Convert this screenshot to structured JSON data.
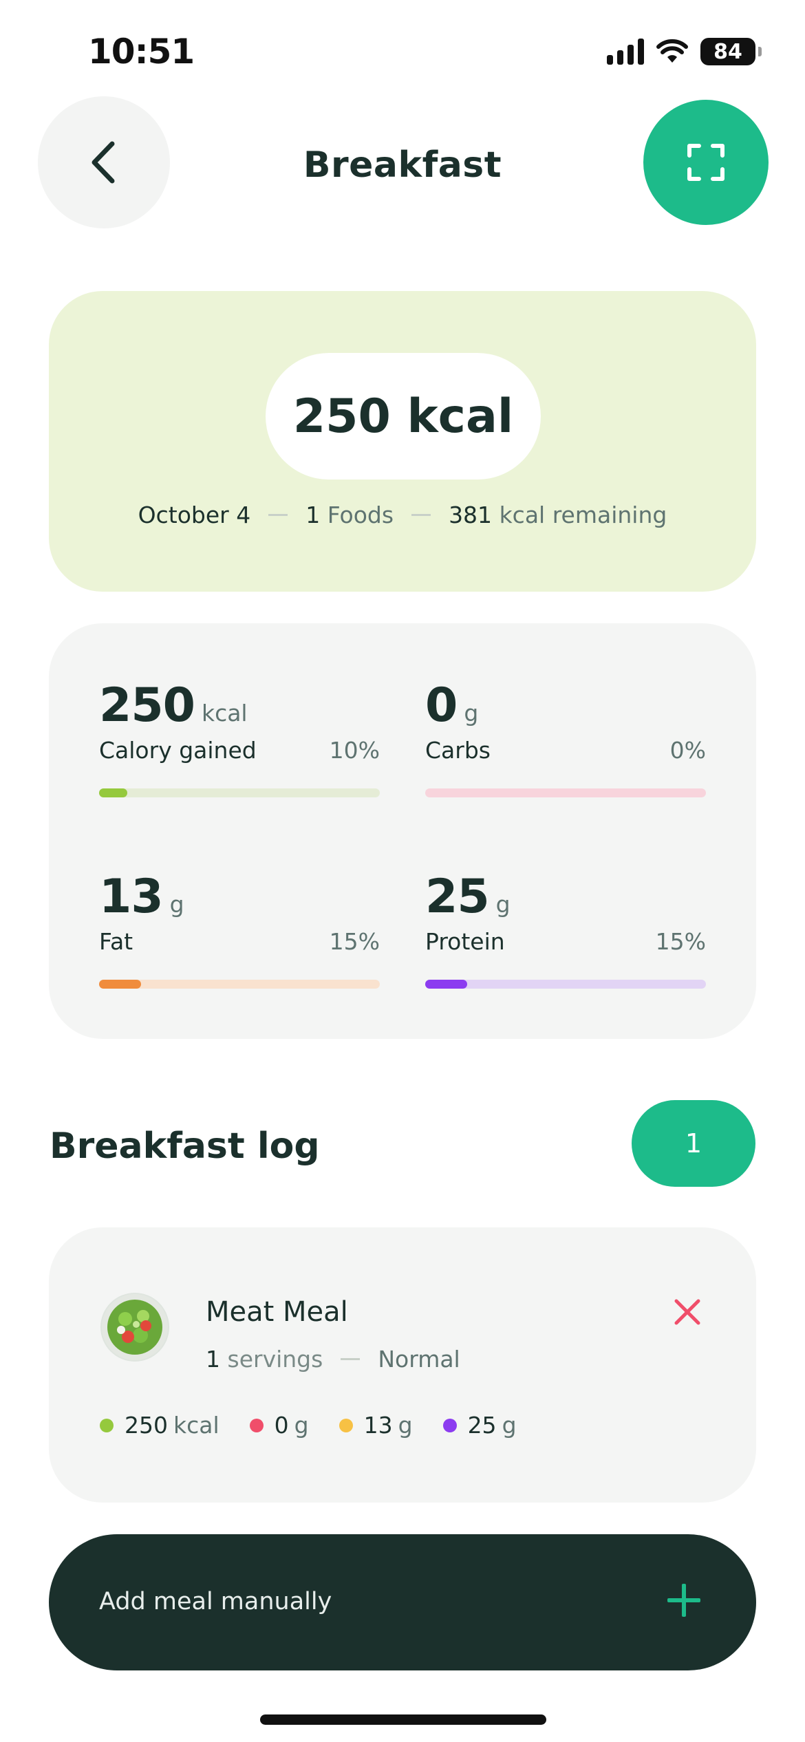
{
  "status_bar": {
    "time": "10:51",
    "battery": "84"
  },
  "header": {
    "title": "Breakfast",
    "back_icon": "chevron-left-icon",
    "scan_icon": "scan-frame-icon"
  },
  "summary": {
    "calories": "250 kcal",
    "date": "October 4",
    "foods_count": "1",
    "foods_label": "Foods",
    "remaining_value": "381",
    "remaining_label": "kcal remaining"
  },
  "macros": [
    {
      "value": "250",
      "unit": "kcal",
      "label": "Calory gained",
      "percent_text": "10%",
      "percent": 10,
      "color": "#95c93d",
      "track": "#e5ecd6"
    },
    {
      "value": "0",
      "unit": "g",
      "label": "Carbs",
      "percent_text": "0%",
      "percent": 0,
      "color": "#f04e6a",
      "track": "#f8d4dc"
    },
    {
      "value": "13",
      "unit": "g",
      "label": "Fat",
      "percent_text": "15%",
      "percent": 15,
      "color": "#f08c3c",
      "track": "#f9e2cf"
    },
    {
      "value": "25",
      "unit": "g",
      "label": "Protein",
      "percent_text": "15%",
      "percent": 15,
      "color": "#8c3cf0",
      "track": "#e2d4f5"
    }
  ],
  "log": {
    "title": "Breakfast log",
    "count": "1",
    "items": [
      {
        "name": "Meat Meal",
        "servings_value": "1",
        "servings_label": "servings",
        "size": "Normal",
        "macros": [
          {
            "value": "250",
            "unit": "kcal",
            "color": "#95c93d"
          },
          {
            "value": "0",
            "unit": "g",
            "color": "#f04e6a"
          },
          {
            "value": "13",
            "unit": "g",
            "color": "#f7c144"
          },
          {
            "value": "25",
            "unit": "g",
            "color": "#8c3cf0"
          }
        ]
      }
    ]
  },
  "add_meal": {
    "label": "Add meal manually"
  },
  "colors": {
    "accent": "#1dbb8a",
    "dark": "#1b302c",
    "summary_bg": "#ecf4d7",
    "remove": "#f04e6a"
  }
}
